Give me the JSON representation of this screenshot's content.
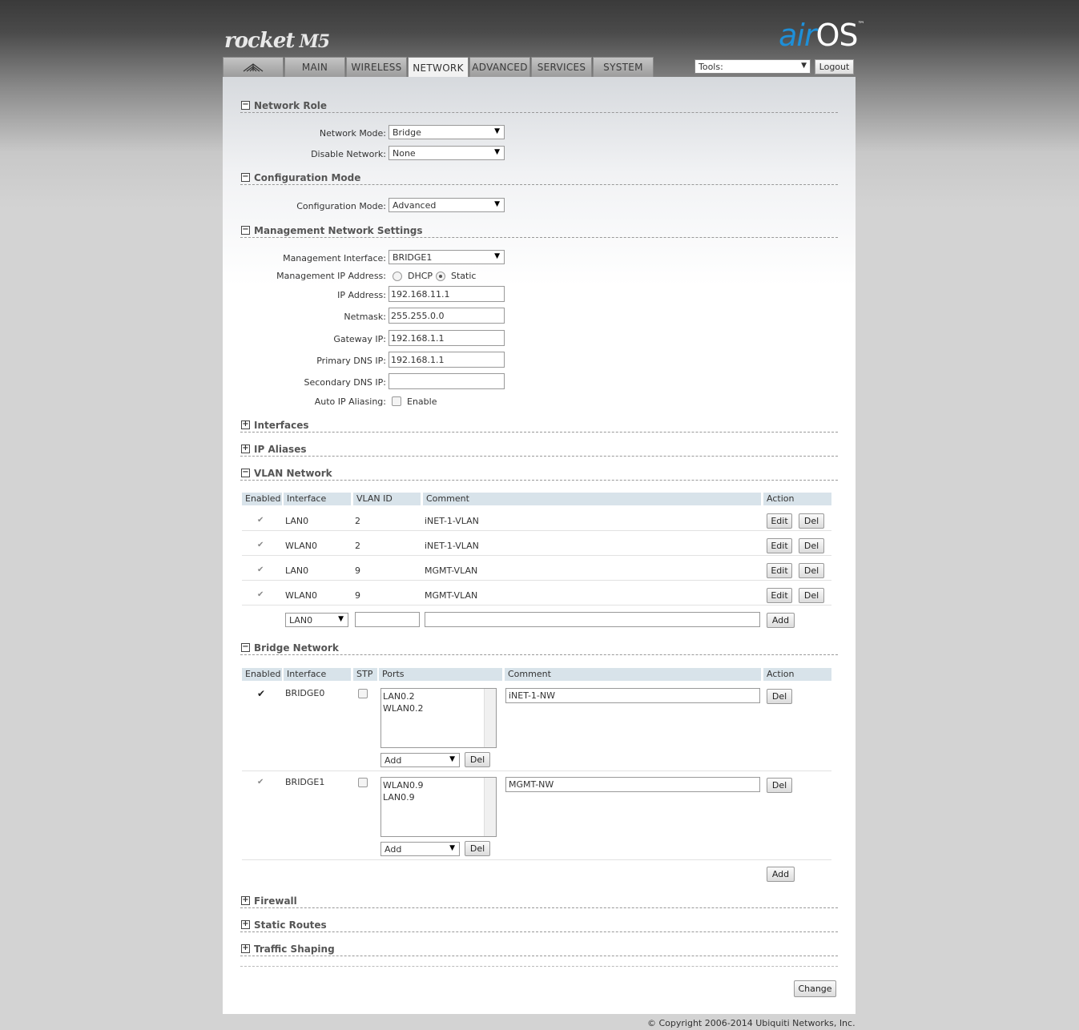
{
  "header": {
    "logo": "rocket",
    "model": "M5",
    "brand_air": "air",
    "brand_os": "OS",
    "tm": "™"
  },
  "tabs": [
    {
      "label": "",
      "icon": "ubiquiti-logo-icon"
    },
    {
      "label": "MAIN"
    },
    {
      "label": "WIRELESS"
    },
    {
      "label": "NETWORK",
      "active": true
    },
    {
      "label": "ADVANCED"
    },
    {
      "label": "SERVICES"
    },
    {
      "label": "SYSTEM"
    }
  ],
  "tools": {
    "value": "Tools:"
  },
  "logout": "Logout",
  "sections": {
    "network_role": "Network Role",
    "config_mode": "Configuration Mode",
    "mgmt": "Management Network Settings",
    "interfaces": "Interfaces",
    "ip_aliases": "IP Aliases",
    "vlan": "VLAN Network",
    "bridge": "Bridge Network",
    "firewall": "Firewall",
    "static_routes": "Static Routes",
    "traffic_shaping": "Traffic Shaping"
  },
  "network_role": {
    "mode_label": "Network Mode:",
    "mode_value": "Bridge",
    "disable_label": "Disable Network:",
    "disable_value": "None"
  },
  "config_mode": {
    "label": "Configuration Mode:",
    "value": "Advanced"
  },
  "mgmt": {
    "interface_label": "Management Interface:",
    "interface_value": "BRIDGE1",
    "ip_addr_label": "Management IP Address:",
    "dhcp": "DHCP",
    "static": "Static",
    "ip_label": "IP Address:",
    "ip": "192.168.11.1",
    "netmask_label": "Netmask:",
    "netmask": "255.255.0.0",
    "gateway_label": "Gateway IP:",
    "gateway": "192.168.1.1",
    "dns1_label": "Primary DNS IP:",
    "dns1": "192.168.1.1",
    "dns2_label": "Secondary DNS IP:",
    "dns2": "",
    "alias_label": "Auto IP Aliasing:",
    "alias_enable": "Enable"
  },
  "vlan": {
    "headers": {
      "enabled": "Enabled",
      "interface": "Interface",
      "vlan_id": "VLAN ID",
      "comment": "Comment",
      "action": "Action"
    },
    "rows": [
      {
        "interface": "LAN0",
        "vlan_id": "2",
        "comment": "iNET-1-VLAN"
      },
      {
        "interface": "WLAN0",
        "vlan_id": "2",
        "comment": "iNET-1-VLAN"
      },
      {
        "interface": "LAN0",
        "vlan_id": "9",
        "comment": "MGMT-VLAN"
      },
      {
        "interface": "WLAN0",
        "vlan_id": "9",
        "comment": "MGMT-VLAN"
      }
    ],
    "edit": "Edit",
    "del": "Del",
    "add": "Add",
    "new_interface": "LAN0"
  },
  "bridge": {
    "headers": {
      "enabled": "Enabled",
      "interface": "Interface",
      "stp": "STP",
      "ports": "Ports",
      "comment": "Comment",
      "action": "Action"
    },
    "rows": [
      {
        "interface": "BRIDGE0",
        "ports": [
          "LAN0.2",
          "WLAN0.2"
        ],
        "comment": "iNET-1-NW"
      },
      {
        "interface": "BRIDGE1",
        "ports": [
          "WLAN0.9",
          "LAN0.9"
        ],
        "comment": "MGMT-NW"
      }
    ],
    "add_select": "Add",
    "del": "Del",
    "add": "Add"
  },
  "change": "Change",
  "copyright": "© Copyright 2006-2014 Ubiquiti Networks, Inc."
}
